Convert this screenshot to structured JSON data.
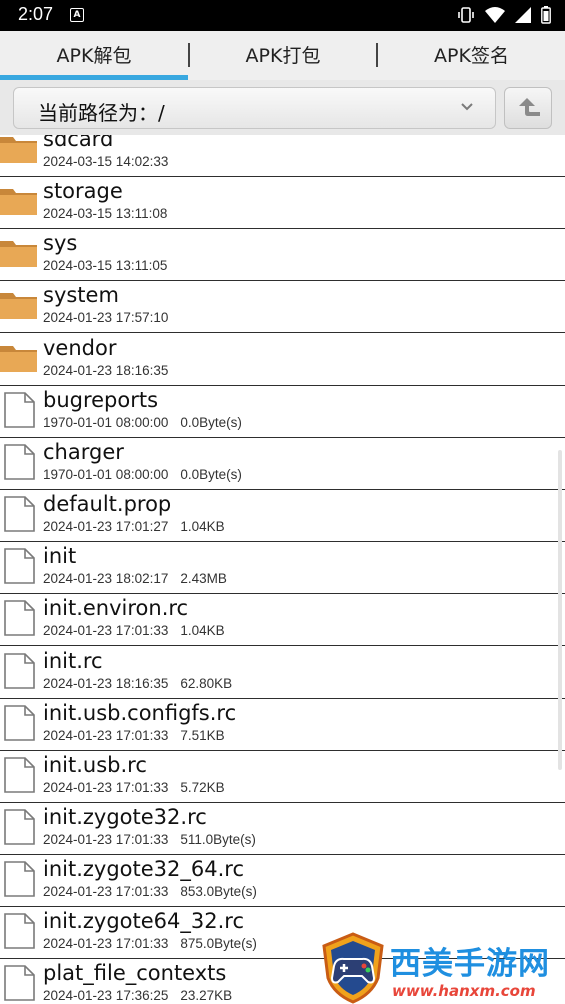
{
  "status_bar": {
    "time": "2:07",
    "notification_glyph": "A"
  },
  "tabs": [
    {
      "label": "APK解包",
      "active": true
    },
    {
      "label": "APK打包",
      "active": false
    },
    {
      "label": "APK签名",
      "active": false
    }
  ],
  "path": {
    "text": "当前路径为：/"
  },
  "files": [
    {
      "name": "sdcard",
      "meta": "2024-03-15 14:02:33",
      "size": "",
      "type": "folder"
    },
    {
      "name": "storage",
      "meta": "2024-03-15 13:11:08",
      "size": "",
      "type": "folder"
    },
    {
      "name": "sys",
      "meta": "2024-03-15 13:11:05",
      "size": "",
      "type": "folder"
    },
    {
      "name": "system",
      "meta": "2024-01-23 17:57:10",
      "size": "",
      "type": "folder"
    },
    {
      "name": "vendor",
      "meta": "2024-01-23 18:16:35",
      "size": "",
      "type": "folder"
    },
    {
      "name": "bugreports",
      "meta": "1970-01-01 08:00:00",
      "size": "0.0Byte(s)",
      "type": "file"
    },
    {
      "name": "charger",
      "meta": "1970-01-01 08:00:00",
      "size": "0.0Byte(s)",
      "type": "file"
    },
    {
      "name": "default.prop",
      "meta": "2024-01-23 17:01:27",
      "size": "1.04KB",
      "type": "file"
    },
    {
      "name": "init",
      "meta": "2024-01-23 18:02:17",
      "size": "2.43MB",
      "type": "file"
    },
    {
      "name": "init.environ.rc",
      "meta": "2024-01-23 17:01:33",
      "size": "1.04KB",
      "type": "file"
    },
    {
      "name": "init.rc",
      "meta": "2024-01-23 18:16:35",
      "size": "62.80KB",
      "type": "file"
    },
    {
      "name": "init.usb.configfs.rc",
      "meta": "2024-01-23 17:01:33",
      "size": "7.51KB",
      "type": "file"
    },
    {
      "name": "init.usb.rc",
      "meta": "2024-01-23 17:01:33",
      "size": "5.72KB",
      "type": "file"
    },
    {
      "name": "init.zygote32.rc",
      "meta": "2024-01-23 17:01:33",
      "size": "511.0Byte(s)",
      "type": "file"
    },
    {
      "name": "init.zygote32_64.rc",
      "meta": "2024-01-23 17:01:33",
      "size": "853.0Byte(s)",
      "type": "file"
    },
    {
      "name": "init.zygote64_32.rc",
      "meta": "2024-01-23 17:01:33",
      "size": "875.0Byte(s)",
      "type": "file"
    },
    {
      "name": "plat_file_contexts",
      "meta": "2024-01-23 17:36:25",
      "size": "23.27KB",
      "type": "file"
    }
  ],
  "watermark": {
    "title": "西美手游网",
    "url": "www.hanxm.com"
  },
  "colors": {
    "accent": "#39a8e0",
    "folder": "#e3a24c"
  }
}
